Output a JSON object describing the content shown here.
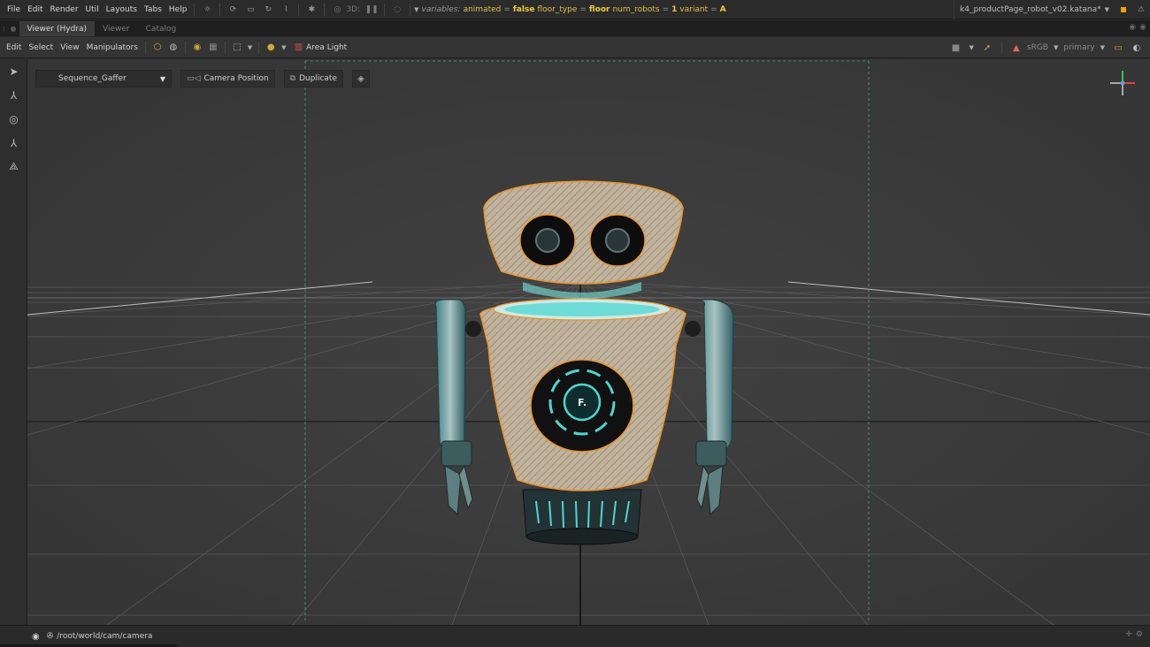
{
  "menubar": {
    "items": [
      "File",
      "Edit",
      "Render",
      "Util",
      "Layouts",
      "Tabs",
      "Help"
    ],
    "three_d_label": "3D:",
    "variables": {
      "label": "variables:",
      "pairs": [
        {
          "key": "animated",
          "value": "false"
        },
        {
          "key": "floor_type",
          "value": "floor"
        },
        {
          "key": "num_robots",
          "value": "1"
        },
        {
          "key": "variant",
          "value": "A"
        }
      ]
    },
    "project": "k4_productPage_robot_v02.katana*"
  },
  "tabs": [
    {
      "label": "Viewer (Hydra)",
      "active": true
    },
    {
      "label": "Viewer",
      "active": false
    },
    {
      "label": "Catalog",
      "active": false
    }
  ],
  "toolbar": {
    "menus": [
      "Edit",
      "Select",
      "View",
      "Manipulators"
    ],
    "light_label": "Area Light",
    "colorspace": "sRGB",
    "display": "primary"
  },
  "viewport": {
    "sequence": "Sequence_Gaffer",
    "camera_position_label": "Camera Position",
    "duplicate_label": "Duplicate",
    "robot_logo": "F."
  },
  "status": {
    "camera_path": "/root/world/cam/camera"
  },
  "colors": {
    "selection_outline": "#e8962e",
    "robot_glow": "#4fd6d0",
    "variable_value": "#f0cb3c",
    "accent_orange": "#f39c12"
  }
}
